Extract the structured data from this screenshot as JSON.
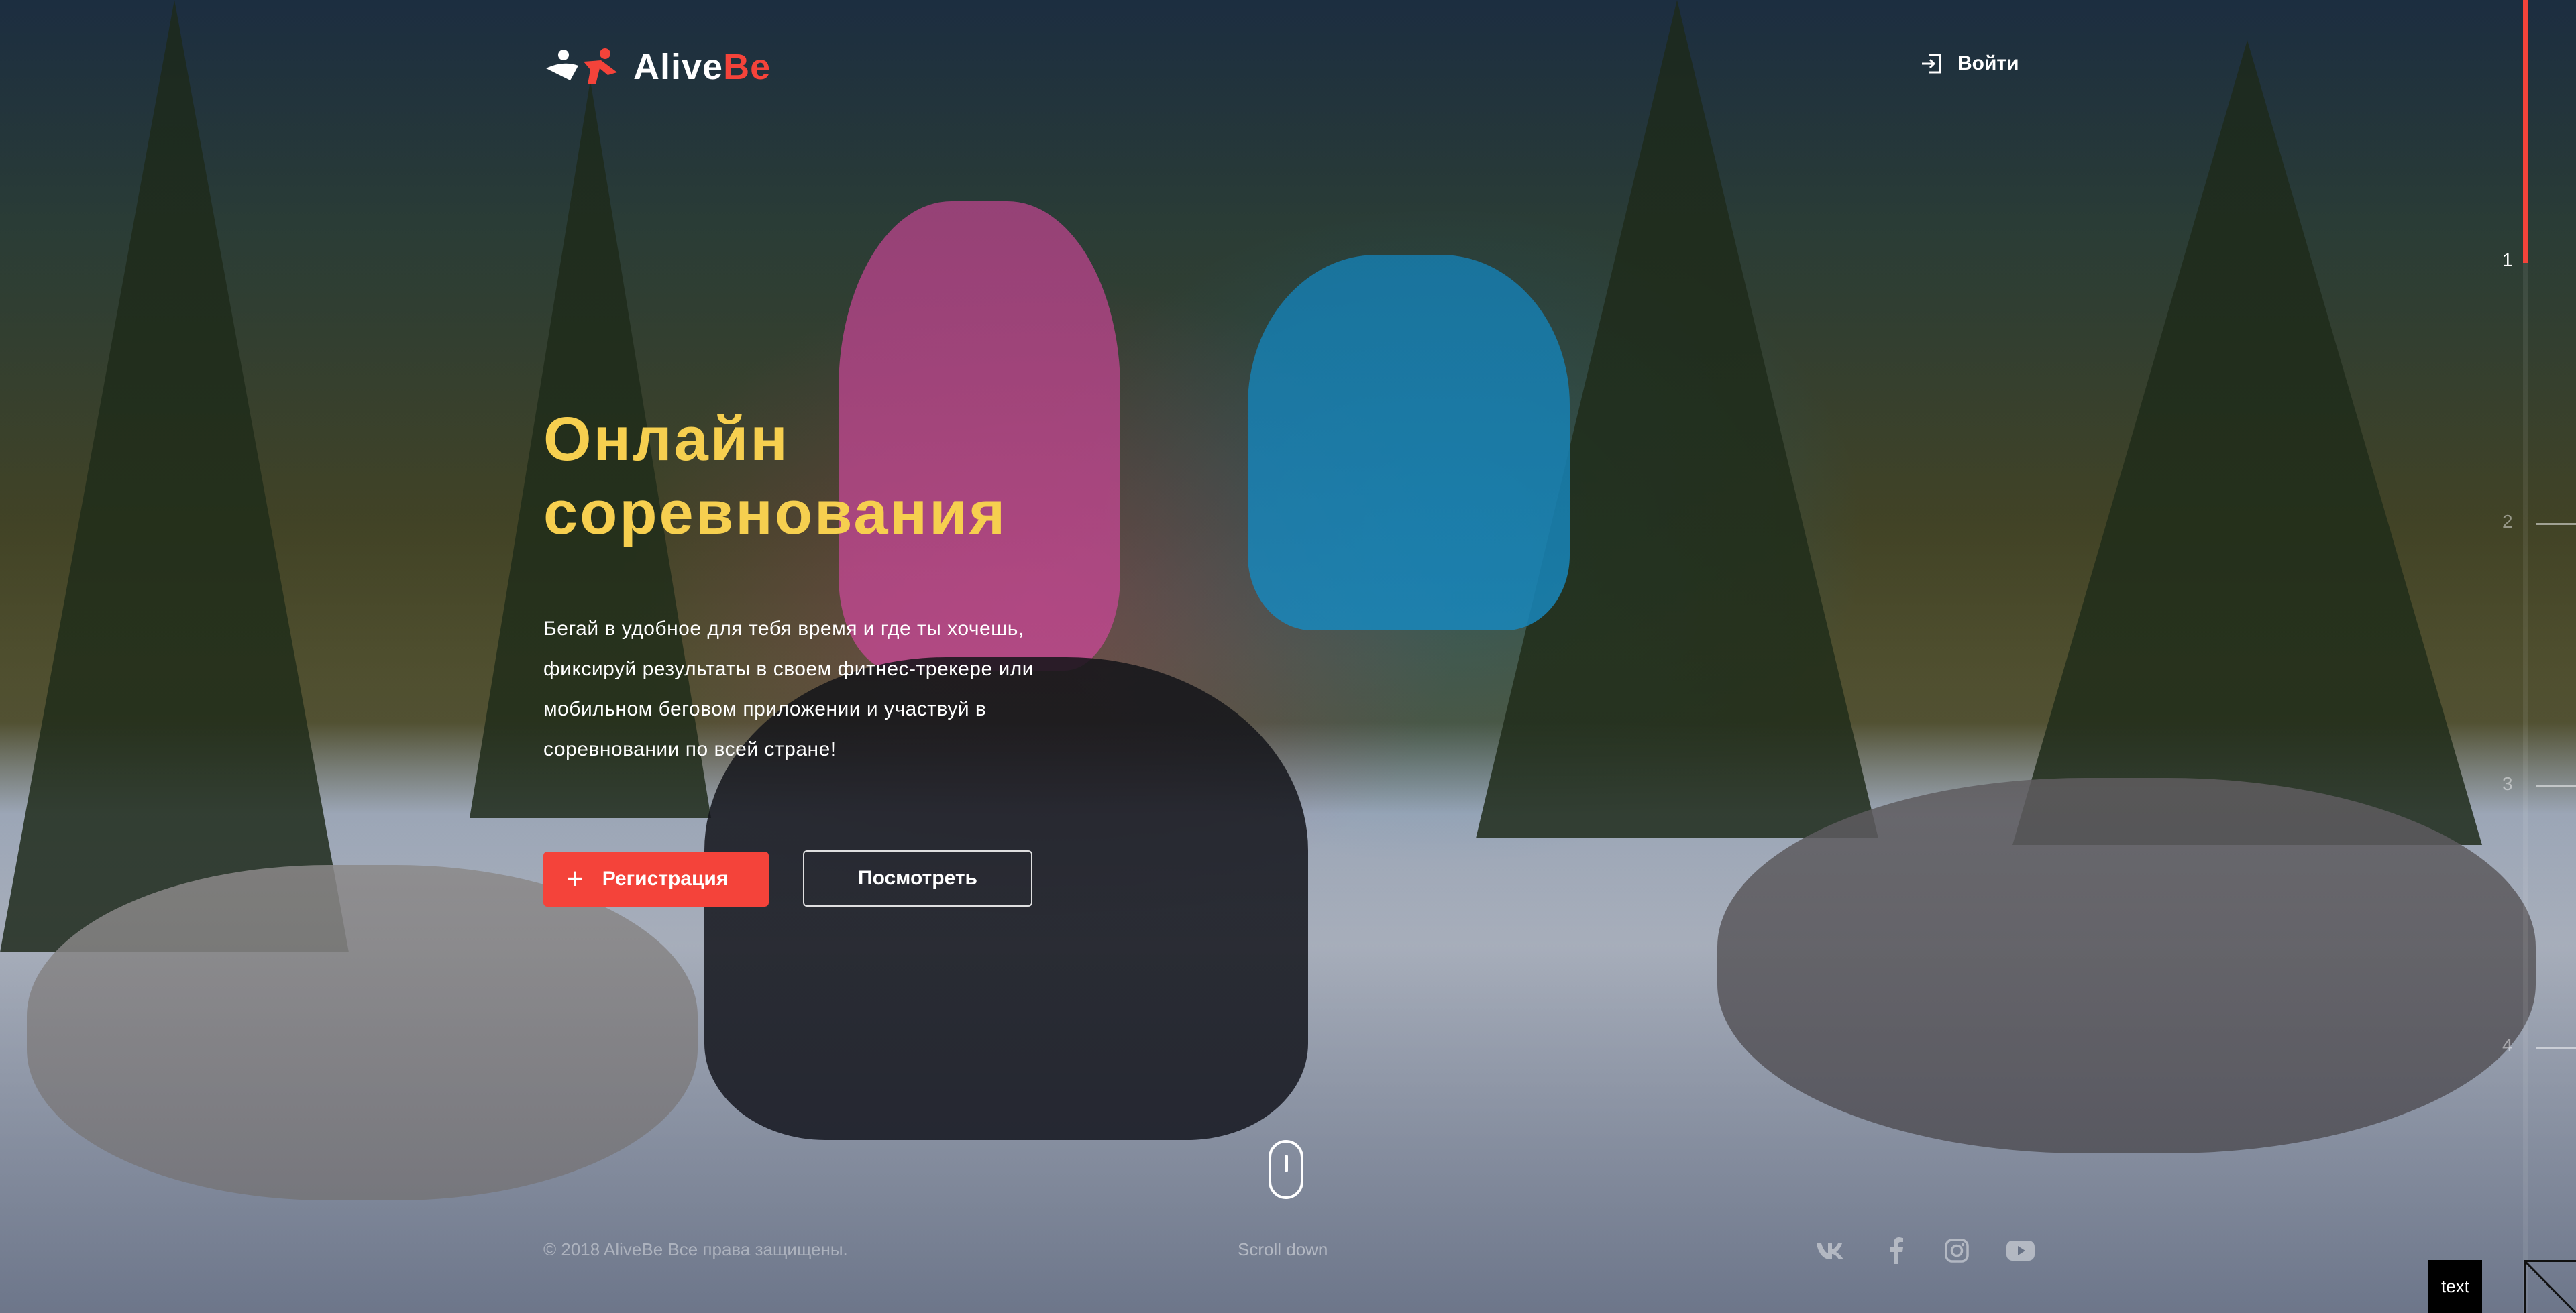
{
  "brand": {
    "name_main": "Alive",
    "name_accent": "Be",
    "accent_color": "#f4433a"
  },
  "header": {
    "login_label": "Войти",
    "login_icon": "login-icon"
  },
  "hero": {
    "title_line1": "Онлайн",
    "title_line2": "соревнования",
    "title_color": "#f6cf4f",
    "description": "Бегай в удобное для тебя время и где ты хочешь, фиксируй результаты в своем фитнес-трекере или мобильном беговом приложении и участвуй в соревновании по всей стране!"
  },
  "actions": {
    "register_label": "Регистрация",
    "register_icon": "plus-icon",
    "view_label": "Посмотреть"
  },
  "scroll": {
    "label": "Scroll down"
  },
  "footer": {
    "copyright": "© 2018 AliveBe Все права защищены."
  },
  "social": [
    {
      "name": "vk-icon"
    },
    {
      "name": "facebook-icon"
    },
    {
      "name": "instagram-icon"
    },
    {
      "name": "youtube-icon"
    }
  ],
  "pager": {
    "items": [
      "1",
      "2",
      "3",
      "4"
    ],
    "active": "1",
    "progress": 0.2
  },
  "badge": {
    "label": "text"
  }
}
